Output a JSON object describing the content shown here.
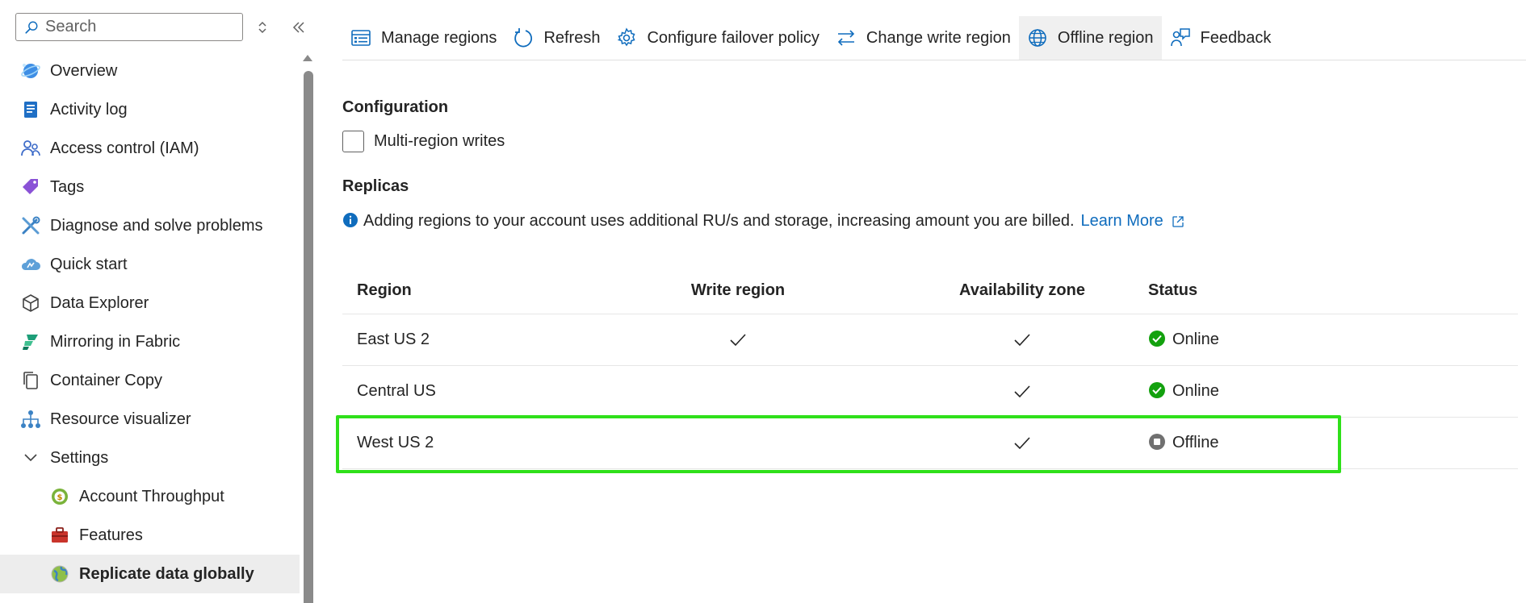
{
  "sidebar": {
    "search": {
      "placeholder": "Search",
      "value": ""
    },
    "items": [
      {
        "label": "Overview",
        "icon": "cosmos-db-icon"
      },
      {
        "label": "Activity log",
        "icon": "activity-log-icon"
      },
      {
        "label": "Access control (IAM)",
        "icon": "people-icon"
      },
      {
        "label": "Tags",
        "icon": "tag-icon"
      },
      {
        "label": "Diagnose and solve problems",
        "icon": "wrench-icon"
      },
      {
        "label": "Quick start",
        "icon": "cloud-icon"
      },
      {
        "label": "Data Explorer",
        "icon": "cube-icon"
      },
      {
        "label": "Mirroring in Fabric",
        "icon": "fabric-icon"
      },
      {
        "label": "Container Copy",
        "icon": "copy-icon"
      },
      {
        "label": "Resource visualizer",
        "icon": "hierarchy-icon"
      },
      {
        "label": "Settings",
        "icon": "chevron-down-icon"
      },
      {
        "label": "Account Throughput",
        "icon": "throughput-icon"
      },
      {
        "label": "Features",
        "icon": "toolbox-icon"
      },
      {
        "label": "Replicate data globally",
        "icon": "globe-icon"
      }
    ]
  },
  "toolbar": {
    "manage_regions": "Manage regions",
    "refresh": "Refresh",
    "configure_failover": "Configure failover policy",
    "change_write_region": "Change write region",
    "offline_region": "Offline region",
    "feedback": "Feedback"
  },
  "configuration": {
    "title": "Configuration",
    "multi_region_writes_label": "Multi-region writes",
    "multi_region_writes_checked": false
  },
  "replicas": {
    "title": "Replicas",
    "info_text": "Adding regions to your account uses additional RU/s and storage, increasing amount you are billed.",
    "learn_more": "Learn More",
    "columns": [
      "Region",
      "Write region",
      "Availability zone",
      "Status"
    ],
    "rows": [
      {
        "region": "East US 2",
        "write_region": true,
        "availability_zone": true,
        "status": "Online"
      },
      {
        "region": "Central US",
        "write_region": false,
        "availability_zone": true,
        "status": "Online"
      },
      {
        "region": "West US 2",
        "write_region": false,
        "availability_zone": true,
        "status": "Offline"
      }
    ]
  },
  "colors": {
    "accent": "#0f6cbd",
    "online": "#13a10e",
    "offline": "#616161",
    "highlight": "#2fe01a"
  }
}
